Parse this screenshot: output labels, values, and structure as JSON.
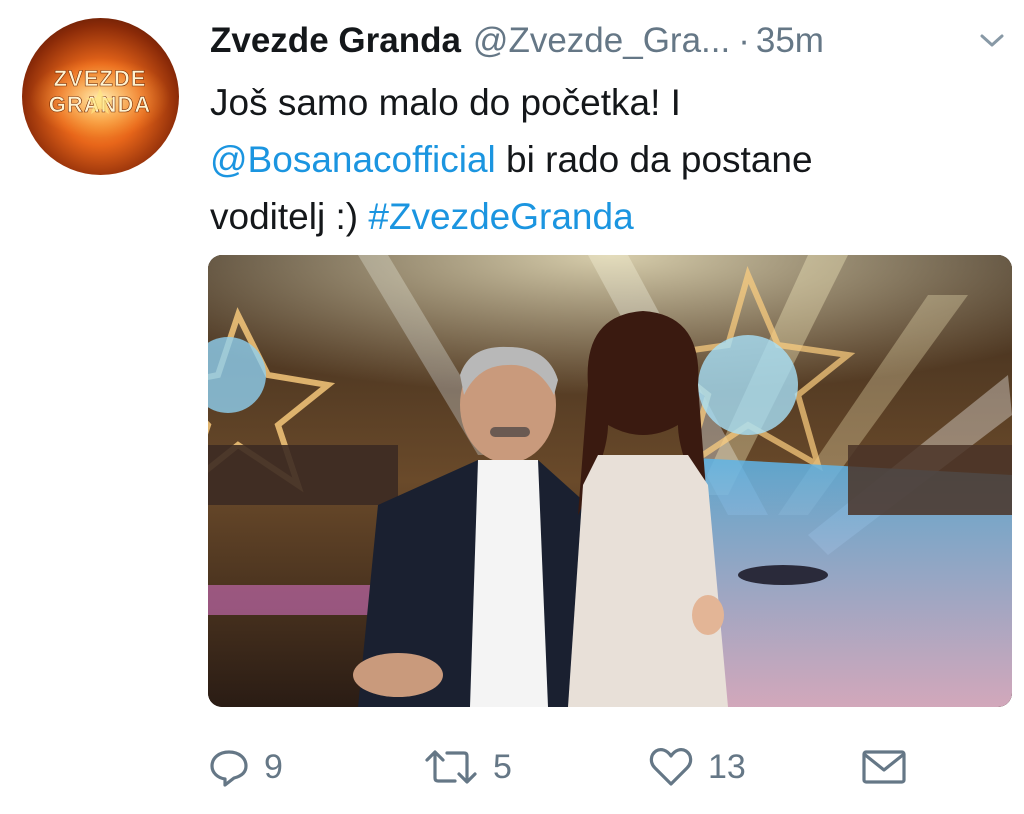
{
  "account": {
    "display_name": "Zvezde Granda",
    "handle": "@Zvezde_Gra...",
    "separator": "·",
    "timestamp": "35m",
    "avatar_text_line1": "ZVEZDE",
    "avatar_text_line2": "GRANDA"
  },
  "tweet": {
    "line1": "Još samo malo do početka! I",
    "mention": "@Bosanacofficial",
    "line2_rest": " bi rado da postane",
    "line3_start": "voditelj :) ",
    "hashtag": "#ZvezdeGranda"
  },
  "actions": {
    "reply_count": "9",
    "retweet_count": "5",
    "like_count": "13"
  },
  "colors": {
    "link": "#1b95e0",
    "secondary_text": "#657786",
    "primary_text": "#14171a"
  },
  "icons": {
    "caret": "chevron-down-icon",
    "reply": "reply-icon",
    "retweet": "retweet-icon",
    "like": "heart-icon",
    "share": "mail-icon"
  }
}
